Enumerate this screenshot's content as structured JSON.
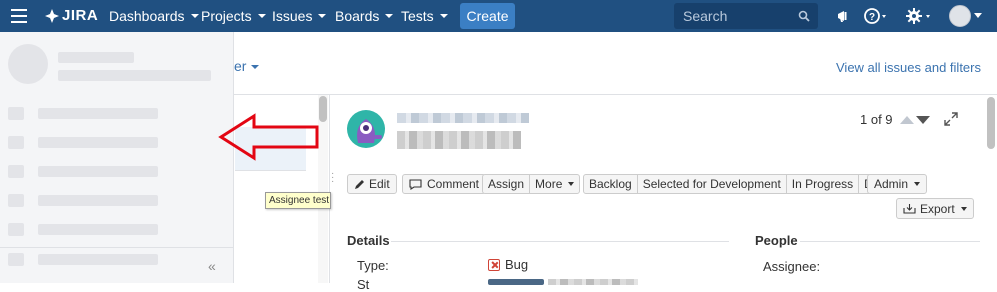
{
  "topbar": {
    "logo_text": "JIRA",
    "nav": [
      "Dashboards",
      "Projects",
      "Issues",
      "Boards",
      "Tests"
    ],
    "create_label": "Create",
    "search_placeholder": "Search"
  },
  "filter_fragment": "er",
  "view_all_link": "View all issues and filters",
  "tooltip": "Assignee test",
  "pager": {
    "counter": "1 of 9"
  },
  "toolbar": {
    "edit": "Edit",
    "comment": "Comment",
    "assign": "Assign",
    "more": "More",
    "workflow": [
      "Backlog",
      "Selected for Development",
      "In Progress",
      "Done"
    ],
    "admin": "Admin",
    "export": "Export"
  },
  "details": {
    "heading": "Details",
    "type_label": "Type:",
    "type_value": "Bug",
    "status_label": "St"
  },
  "people": {
    "heading": "People",
    "assignee_label": "Assignee:"
  },
  "sidebar": {
    "collapse_glyph": "«"
  },
  "colors": {
    "header": "#205081",
    "create": "#3b7fc4",
    "link": "#3b73af",
    "annotation": "#e30613"
  }
}
